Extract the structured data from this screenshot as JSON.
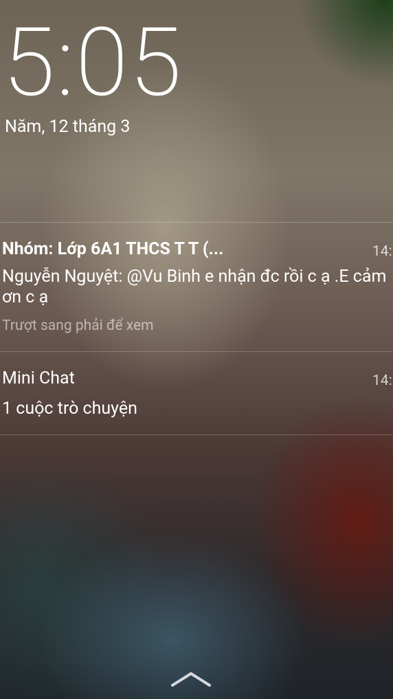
{
  "lockscreen": {
    "time": "5:05",
    "date": "Năm, 12 tháng 3"
  },
  "notifications": [
    {
      "title": "Nhóm: Lớp 6A1 THCS T T (...",
      "time": "14:",
      "body": "Nguyễn Nguyệt: @Vu Binh e nhận đc rồi c ạ .E cảm ơn c ạ",
      "hint": "Trượt sang phải để xem"
    },
    {
      "title": "Mini Chat",
      "time": "14:",
      "body": "1 cuộc trò chuyện"
    }
  ],
  "icons": {
    "swipe_up": "chevron-up-icon"
  }
}
